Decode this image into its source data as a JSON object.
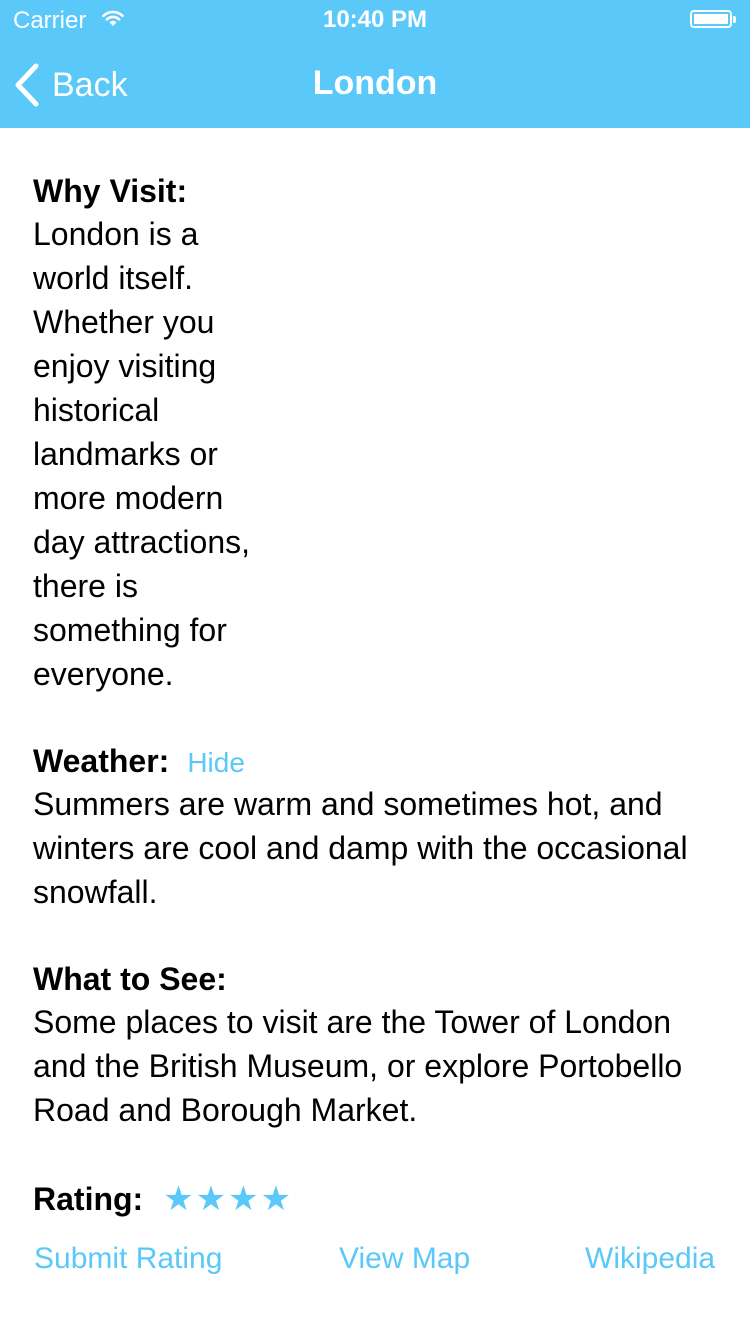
{
  "status_bar": {
    "carrier": "Carrier",
    "time": "10:40 PM"
  },
  "nav": {
    "back_label": "Back",
    "title": "London"
  },
  "why_visit": {
    "heading": "Why Visit:",
    "text": "London is a world itself. Whether you enjoy visiting historical landmarks or more modern day attractions, there is something for everyone."
  },
  "weather": {
    "heading": "Weather:",
    "toggle_label": "Hide",
    "text": "Summers are warm and sometimes hot, and winters are cool and damp with the occasional snowfall."
  },
  "what_to_see": {
    "heading": "What to See:",
    "text": "Some places to visit are the Tower of London and the British Museum, or explore Portobello Road and Borough Market."
  },
  "rating": {
    "heading": "Rating:",
    "value": 4,
    "stars": [
      "★",
      "★",
      "★",
      "★"
    ]
  },
  "actions": {
    "submit_rating": "Submit Rating",
    "view_map": "View Map",
    "wikipedia": "Wikipedia"
  },
  "colors": {
    "accent": "#5ac8f8",
    "nav_background": "#5ac8f8",
    "text": "#000000"
  },
  "icons": {
    "back": "chevron-left-icon",
    "wifi": "wifi-icon",
    "battery": "battery-icon",
    "star": "star-icon"
  }
}
